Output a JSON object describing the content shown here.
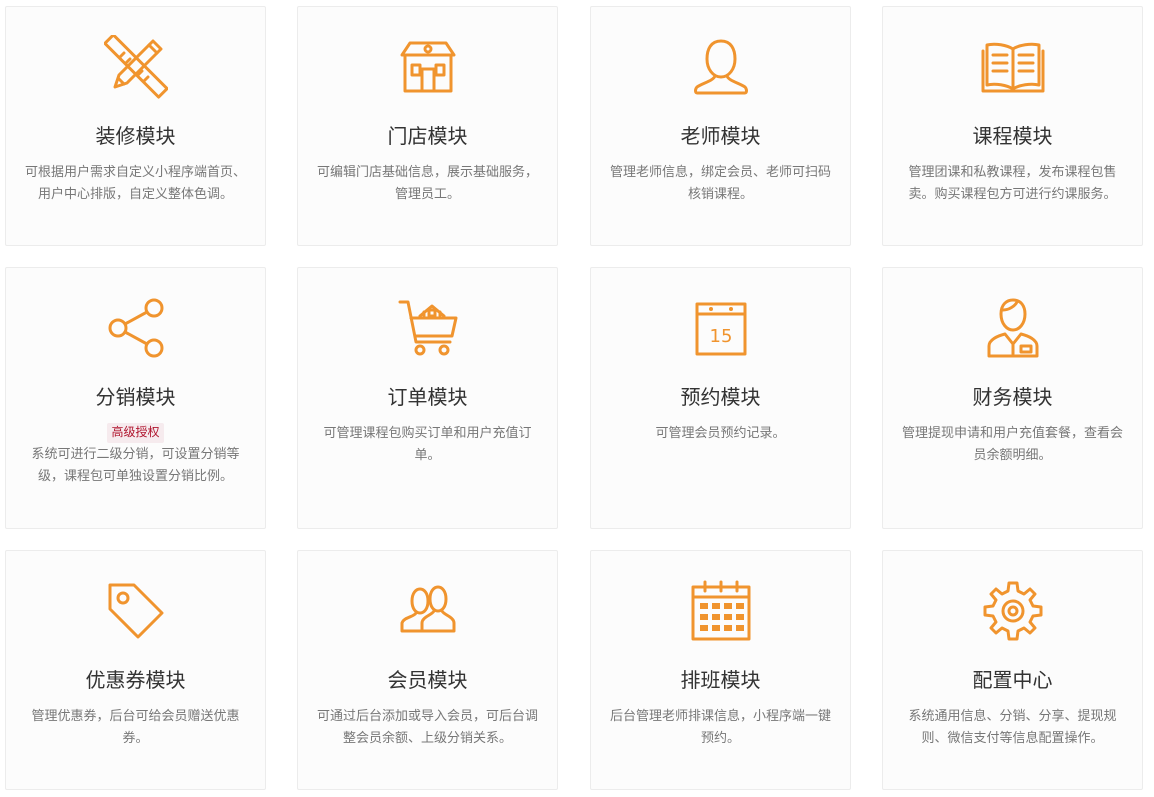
{
  "accent_color": "#f0942e",
  "modules": [
    {
      "icon": "ruler-pencil-icon",
      "title": "装修模块",
      "desc": "可根据用户需求自定义小程序端首页、用户中心排版，自定义整体色调。"
    },
    {
      "icon": "storefront-icon",
      "title": "门店模块",
      "desc": "可编辑门店基础信息，展示基础服务，管理员工。"
    },
    {
      "icon": "person-icon",
      "title": "老师模块",
      "desc": "管理老师信息，绑定会员、老师可扫码核销课程。"
    },
    {
      "icon": "book-icon",
      "title": "课程模块",
      "desc": "管理团课和私教课程，发布课程包售卖。购买课程包方可进行约课服务。"
    },
    {
      "icon": "share-icon",
      "title": "分销模块",
      "badge": "高级授权",
      "desc": "系统可进行二级分销，可设置分销等级，课程包可单独设置分销比例。"
    },
    {
      "icon": "shopping-cart-icon",
      "title": "订单模块",
      "desc": "可管理课程包购买订单和用户充值订单。"
    },
    {
      "icon": "calendar-icon",
      "title": "预约模块",
      "desc": "可管理会员预约记录。",
      "calendar_day": "15"
    },
    {
      "icon": "businessman-icon",
      "title": "财务模块",
      "desc": "管理提现申请和用户充值套餐，查看会员余额明细。"
    },
    {
      "icon": "price-tag-icon",
      "title": "优惠券模块",
      "desc": "管理优惠券，后台可给会员赠送优惠券。"
    },
    {
      "icon": "users-icon",
      "title": "会员模块",
      "desc": "可通过后台添加或导入会员，可后台调整会员余额、上级分销关系。"
    },
    {
      "icon": "schedule-grid-icon",
      "title": "排班模块",
      "desc": "后台管理老师排课信息，小程序端一键预约。"
    },
    {
      "icon": "gear-icon",
      "title": "配置中心",
      "desc": "系统通用信息、分销、分享、提现规则、微信支付等信息配置操作。"
    }
  ]
}
